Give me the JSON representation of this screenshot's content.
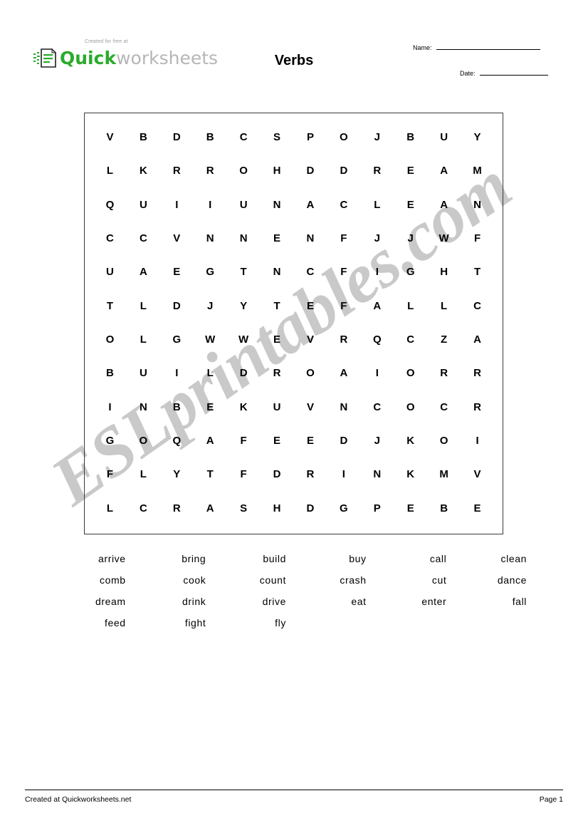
{
  "header": {
    "logo": {
      "tagline": "Created for free at",
      "brand_first": "Quick",
      "brand_second": "worksheets",
      "icon": "document-icon",
      "brand_color": "#2bab2b",
      "brand_secondary_color": "#b6b6b6"
    },
    "title": "Verbs",
    "name_label": "Name:",
    "name_value": "",
    "date_label": "Date:",
    "date_value": ""
  },
  "watermark": {
    "text": "ESLprintables.com",
    "color": "#c9c9c9"
  },
  "puzzle": {
    "rows": 12,
    "columns": 12,
    "grid": [
      [
        "V",
        "B",
        "D",
        "B",
        "C",
        "S",
        "P",
        "O",
        "J",
        "B",
        "U",
        "Y"
      ],
      [
        "L",
        "K",
        "R",
        "R",
        "O",
        "H",
        "D",
        "D",
        "R",
        "E",
        "A",
        "M"
      ],
      [
        "Q",
        "U",
        "I",
        "I",
        "U",
        "N",
        "A",
        "C",
        "L",
        "E",
        "A",
        "N"
      ],
      [
        "C",
        "C",
        "V",
        "N",
        "N",
        "E",
        "N",
        "F",
        "J",
        "J",
        "W",
        "F"
      ],
      [
        "U",
        "A",
        "E",
        "G",
        "T",
        "N",
        "C",
        "F",
        "I",
        "G",
        "H",
        "T"
      ],
      [
        "T",
        "L",
        "D",
        "J",
        "Y",
        "T",
        "E",
        "F",
        "A",
        "L",
        "L",
        "C"
      ],
      [
        "O",
        "L",
        "G",
        "W",
        "W",
        "E",
        "V",
        "R",
        "Q",
        "C",
        "Z",
        "A"
      ],
      [
        "B",
        "U",
        "I",
        "L",
        "D",
        "R",
        "O",
        "A",
        "I",
        "O",
        "R",
        "R"
      ],
      [
        "I",
        "N",
        "B",
        "E",
        "K",
        "U",
        "V",
        "N",
        "C",
        "O",
        "C",
        "R"
      ],
      [
        "G",
        "O",
        "Q",
        "A",
        "F",
        "E",
        "E",
        "D",
        "J",
        "K",
        "O",
        "I"
      ],
      [
        "F",
        "L",
        "Y",
        "T",
        "F",
        "D",
        "R",
        "I",
        "N",
        "K",
        "M",
        "V"
      ],
      [
        "L",
        "C",
        "R",
        "A",
        "S",
        "H",
        "D",
        "G",
        "P",
        "E",
        "B",
        "E"
      ]
    ]
  },
  "wordlist": {
    "columns": 6,
    "words": [
      "arrive",
      "bring",
      "build",
      "buy",
      "call",
      "clean",
      "comb",
      "cook",
      "count",
      "crash",
      "cut",
      "dance",
      "dream",
      "drink",
      "drive",
      "eat",
      "enter",
      "fall",
      "feed",
      "fight",
      "fly"
    ]
  },
  "footer": {
    "left": "Created at  Quickworksheets.net",
    "right": "Page  1"
  }
}
